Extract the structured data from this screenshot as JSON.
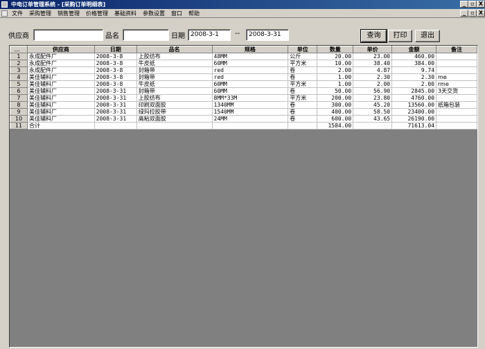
{
  "window": {
    "title": "中电订单管理系统 - [采购订单明细表]"
  },
  "menu": {
    "items": [
      "文件",
      "采购管理",
      "销售管理",
      "价格管理",
      "基础资料",
      "参数设置",
      "窗口",
      "帮助"
    ]
  },
  "window_controls": {
    "minimize": "_",
    "restore": "▫",
    "close": "X"
  },
  "filters": {
    "supplier_label": "供应商",
    "supplier_value": "",
    "product_label": "品名",
    "product_value": "",
    "date_label": "日期",
    "date_from": "2008-3-1",
    "date_sep": "--",
    "date_to": "2008-3-31"
  },
  "toolbar": {
    "query": "查询",
    "print": "打印",
    "exit": "退出"
  },
  "table": {
    "columns": [
      "供应商",
      "日期",
      "品名",
      "规格",
      "单位",
      "数量",
      "单价",
      "金额",
      "备注"
    ],
    "rows": [
      {
        "n": "1",
        "supplier": "永成配件厂",
        "date": "2008-3-8",
        "product": "上胶纺布",
        "spec": "48MM",
        "unit": "公斤",
        "qty": "20.00",
        "price": "23.00",
        "amount": "460.00",
        "note": ""
      },
      {
        "n": "2",
        "supplier": "永成配件厂",
        "date": "2008-3-8",
        "product": "牛皮纸",
        "spec": "60MM",
        "unit": "平方米",
        "qty": "10.00",
        "price": "38.40",
        "amount": "384.00",
        "note": ""
      },
      {
        "n": "3",
        "supplier": "永成配件厂",
        "date": "2008-3-8",
        "product": "封箱带",
        "spec": "red",
        "unit": "卷",
        "qty": "2.00",
        "price": "4.87",
        "amount": "9.74",
        "note": ""
      },
      {
        "n": "4",
        "supplier": "美佳辅料厂",
        "date": "2008-3-8",
        "product": "封箱带",
        "spec": "red",
        "unit": "卷",
        "qty": "1.00",
        "price": "2.30",
        "amount": "2.30",
        "note": "me"
      },
      {
        "n": "5",
        "supplier": "美佳辅料厂",
        "date": "2008-3-8",
        "product": "牛皮纸",
        "spec": "60MM",
        "unit": "平方米",
        "qty": "1.00",
        "price": "2.00",
        "amount": "2.00",
        "note": "rme"
      },
      {
        "n": "6",
        "supplier": "美佳辅料厂",
        "date": "2008-3-31",
        "product": "封箱带",
        "spec": "60MM",
        "unit": "卷",
        "qty": "50.00",
        "price": "56.90",
        "amount": "2845.00",
        "note": "3天交货"
      },
      {
        "n": "7",
        "supplier": "美佳辅料厂",
        "date": "2008-3-31",
        "product": "上胶纺布",
        "spec": "8MM*33M",
        "unit": "平方米",
        "qty": "200.00",
        "price": "23.80",
        "amount": "4760.00",
        "note": ""
      },
      {
        "n": "8",
        "supplier": "美佳辅料厂",
        "date": "2008-3-31",
        "product": "印刷双面胶",
        "spec": "1340MM",
        "unit": "卷",
        "qty": "300.00",
        "price": "45.20",
        "amount": "13560.00",
        "note": "纸箱包装"
      },
      {
        "n": "9",
        "supplier": "美佳辅料厂",
        "date": "2008-3-31",
        "product": "绿玛拉胶带",
        "spec": "1540MM",
        "unit": "卷",
        "qty": "400.00",
        "price": "58.50",
        "amount": "23400.00",
        "note": ""
      },
      {
        "n": "10",
        "supplier": "美佳辅料厂",
        "date": "2008-3-31",
        "product": "高粘双面胶",
        "spec": "24MM",
        "unit": "卷",
        "qty": "600.00",
        "price": "43.65",
        "amount": "26190.00",
        "note": ""
      },
      {
        "n": "11",
        "supplier": "合计",
        "date": "",
        "product": "",
        "spec": "",
        "unit": "",
        "qty": "1584.00",
        "price": "",
        "amount": "71613.04",
        "note": ""
      }
    ]
  }
}
